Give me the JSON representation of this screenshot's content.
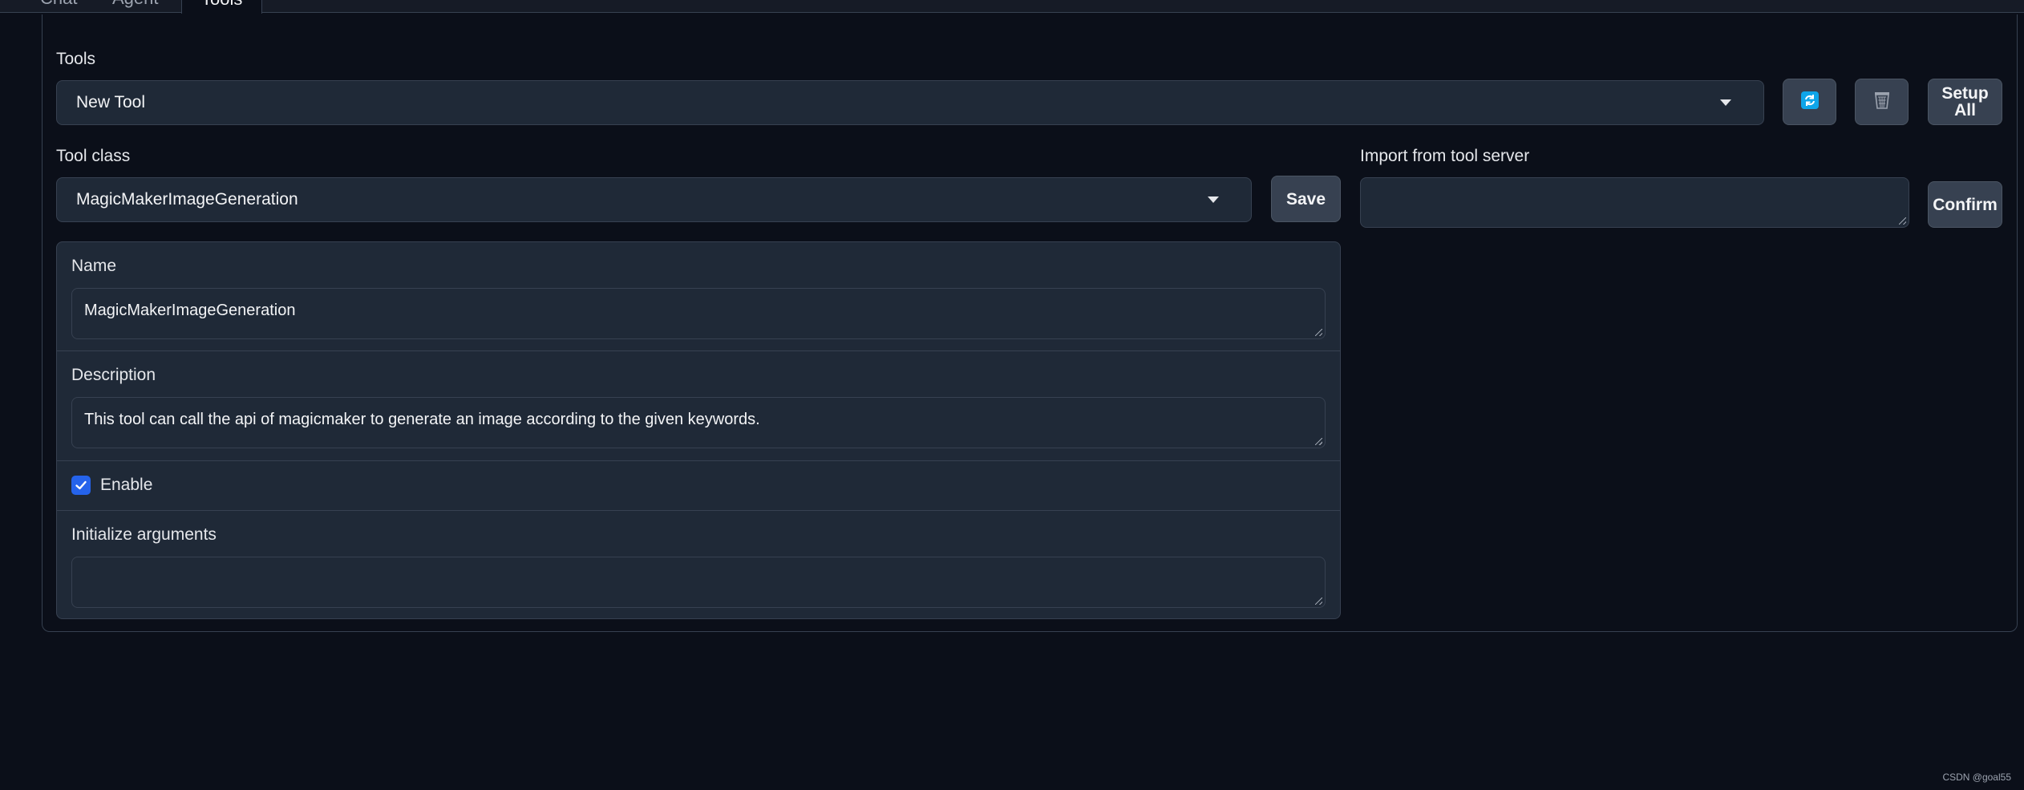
{
  "tabs": [
    "Chat",
    "Agent",
    "Tools"
  ],
  "tools_section": {
    "label": "Tools",
    "selected_tool": "New Tool",
    "refresh_icon": "refresh-icon",
    "delete_icon": "trash-icon",
    "setup_all_label": "Setup All"
  },
  "tool_class": {
    "label": "Tool class",
    "selected": "MagicMakerImageGeneration",
    "save_label": "Save"
  },
  "import_server": {
    "label": "Import from tool server",
    "value": "",
    "confirm_label": "Confirm"
  },
  "form": {
    "name_label": "Name",
    "name_value": "MagicMakerImageGeneration",
    "description_label": "Description",
    "description_value": "This tool can call the api of magicmaker to generate an image according to the given keywords.",
    "enable_label": "Enable",
    "enable_checked": true,
    "init_args_label": "Initialize arguments",
    "init_args_value": ""
  },
  "watermark": "CSDN @goal55",
  "colors": {
    "background": "#0b0f19",
    "surface": "#1f2937",
    "accent": "#2563eb",
    "refresh_icon": "#0ea5e9"
  }
}
